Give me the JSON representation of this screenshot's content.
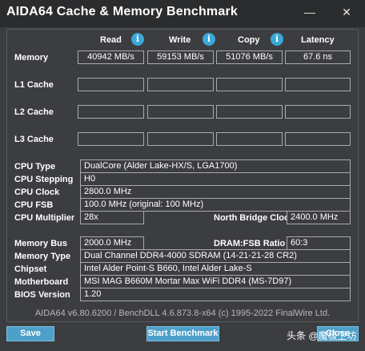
{
  "window": {
    "title": "AIDA64 Cache & Memory Benchmark",
    "minimize_glyph": "—",
    "close_glyph": "✕"
  },
  "columns": {
    "read": "Read",
    "write": "Write",
    "copy": "Copy",
    "latency": "Latency",
    "info_glyph": "i"
  },
  "rows": {
    "memory": {
      "label": "Memory",
      "read": "40942 MB/s",
      "write": "59153 MB/s",
      "copy": "51076 MB/s",
      "latency": "67.6 ns"
    },
    "l1": {
      "label": "L1 Cache",
      "read": "",
      "write": "",
      "copy": "",
      "latency": ""
    },
    "l2": {
      "label": "L2 Cache",
      "read": "",
      "write": "",
      "copy": "",
      "latency": ""
    },
    "l3": {
      "label": "L3 Cache",
      "read": "",
      "write": "",
      "copy": "",
      "latency": ""
    }
  },
  "cpu": {
    "type_label": "CPU Type",
    "type_value": "DualCore   (Alder Lake-HX/S, LGA1700)",
    "stepping_label": "CPU Stepping",
    "stepping_value": "H0",
    "clock_label": "CPU Clock",
    "clock_value": "2800.0 MHz",
    "fsb_label": "CPU FSB",
    "fsb_value": "100.0 MHz  (original: 100 MHz)",
    "multiplier_label": "CPU Multiplier",
    "multiplier_value": "28x",
    "nb_clock_label": "North Bridge Clock",
    "nb_clock_value": "2400.0 MHz"
  },
  "system": {
    "membus_label": "Memory Bus",
    "membus_value": "2000.0 MHz",
    "dramfsb_label": "DRAM:FSB Ratio",
    "dramfsb_value": "60:3",
    "memtype_label": "Memory Type",
    "memtype_value": "Dual Channel DDR4-4000 SDRAM  (14-21-21-28 CR2)",
    "chipset_label": "Chipset",
    "chipset_value": "Intel Alder Point-S B660, Intel Alder Lake-S",
    "motherboard_label": "Motherboard",
    "motherboard_value": "MSI MAG B660M Mortar Max WiFi DDR4 (MS-7D97)",
    "bios_label": "BIOS Version",
    "bios_value": "1.20"
  },
  "footer": {
    "version": "AIDA64 v6.80.6200 / BenchDLL 4.6.873.8-x64  (c) 1995-2022 FinalWire Ltd.",
    "save": "Save",
    "start": "Start Benchmark",
    "close": "Close",
    "watermark": "头条 @魔极卫坊"
  },
  "colors": {
    "background": "#3c3d40",
    "titlebar": "#2b2c2e",
    "button": "#4da0c9",
    "info_icon": "#3aa8d8"
  }
}
